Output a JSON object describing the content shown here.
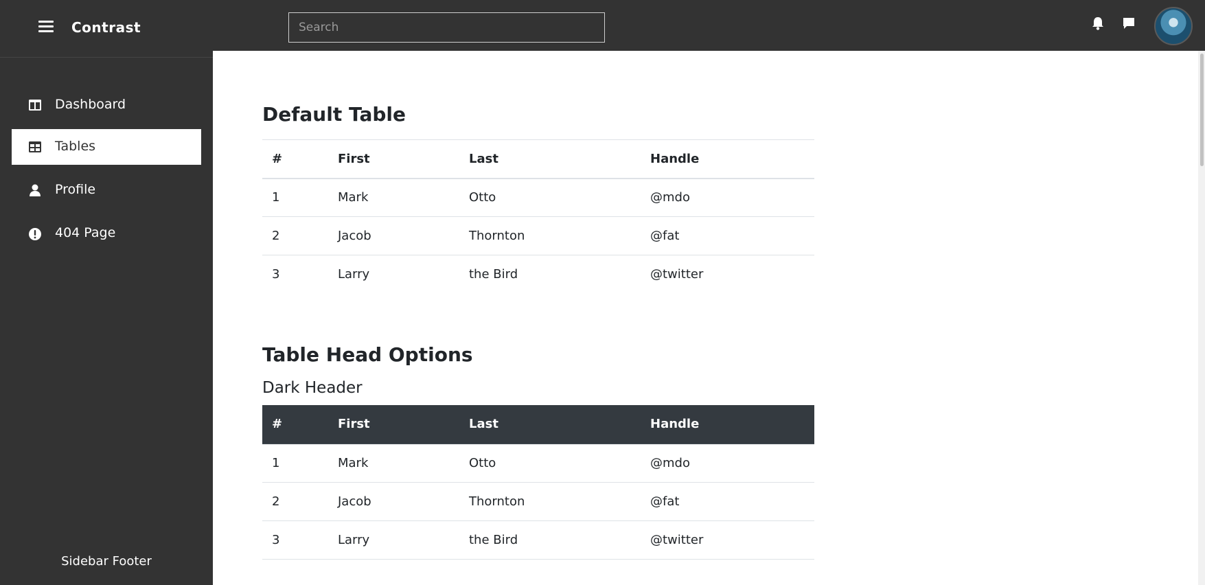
{
  "app": {
    "brand": "Contrast"
  },
  "search": {
    "placeholder": "Search"
  },
  "sidebar": {
    "items": [
      {
        "label": "Dashboard",
        "icon": "dashboard-icon"
      },
      {
        "label": "Tables",
        "icon": "table-icon"
      },
      {
        "label": "Profile",
        "icon": "user-icon"
      },
      {
        "label": "404 Page",
        "icon": "exclamation-circle-icon"
      }
    ],
    "active": "Tables",
    "footer": "Sidebar Footer"
  },
  "main": {
    "default_table": {
      "title": "Default Table",
      "headers": [
        "#",
        "First",
        "Last",
        "Handle"
      ],
      "rows": [
        [
          "1",
          "Mark",
          "Otto",
          "@mdo"
        ],
        [
          "2",
          "Jacob",
          "Thornton",
          "@fat"
        ],
        [
          "3",
          "Larry",
          "the Bird",
          "@twitter"
        ]
      ]
    },
    "head_options": {
      "title": "Table Head Options",
      "subtitle": "Dark Header",
      "headers": [
        "#",
        "First",
        "Last",
        "Handle"
      ],
      "rows": [
        [
          "1",
          "Mark",
          "Otto",
          "@mdo"
        ],
        [
          "2",
          "Jacob",
          "Thornton",
          "@fat"
        ],
        [
          "3",
          "Larry",
          "the Bird",
          "@twitter"
        ]
      ]
    }
  },
  "colors": {
    "topbar": "#333333",
    "sidebar": "#333333",
    "dark_header": "#343a40",
    "content": "#ffffff"
  }
}
